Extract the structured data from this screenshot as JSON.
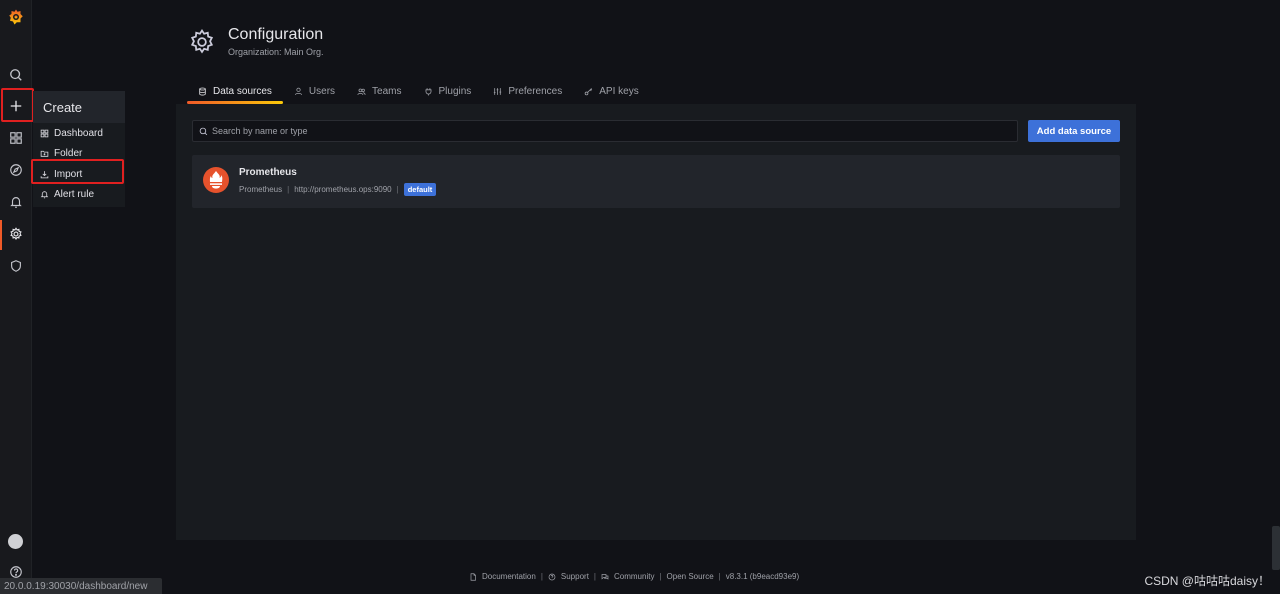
{
  "app": {
    "name": "Grafana"
  },
  "sidebar": {
    "items": [
      {
        "name": "search"
      },
      {
        "name": "create"
      },
      {
        "name": "dashboards"
      },
      {
        "name": "explore"
      },
      {
        "name": "alerting"
      },
      {
        "name": "configuration"
      },
      {
        "name": "server-admin"
      }
    ]
  },
  "create_menu": {
    "title": "Create",
    "items": [
      {
        "label": "Dashboard",
        "icon": "grid-icon"
      },
      {
        "label": "Folder",
        "icon": "folder-plus-icon"
      },
      {
        "label": "Import",
        "icon": "import-icon"
      },
      {
        "label": "Alert rule",
        "icon": "bell-icon"
      }
    ]
  },
  "header": {
    "title": "Configuration",
    "subtitle": "Organization: Main Org."
  },
  "tabs": [
    {
      "label": "Data sources",
      "icon": "database-icon",
      "active": true
    },
    {
      "label": "Users",
      "icon": "user-icon",
      "active": false
    },
    {
      "label": "Teams",
      "icon": "users-icon",
      "active": false
    },
    {
      "label": "Plugins",
      "icon": "plug-icon",
      "active": false
    },
    {
      "label": "Preferences",
      "icon": "sliders-icon",
      "active": false
    },
    {
      "label": "API keys",
      "icon": "key-icon",
      "active": false
    }
  ],
  "search": {
    "placeholder": "Search by name or type"
  },
  "add_button": {
    "label": "Add data source"
  },
  "datasources": [
    {
      "name": "Prometheus",
      "type": "Prometheus",
      "url": "http://prometheus.ops:9090",
      "badge": "default"
    }
  ],
  "footer": {
    "links": [
      "Documentation",
      "Support",
      "Community",
      "Open Source"
    ],
    "version": "v8.3.1 (b9eacd93e9)"
  },
  "statusbar": {
    "url": "20.0.0.19:30030/dashboard/new"
  },
  "watermark": "CSDN @咕咕咕daisy！",
  "colors": {
    "accent": "#f05a28",
    "primary": "#3d71d9",
    "highlight": "#e02020"
  }
}
